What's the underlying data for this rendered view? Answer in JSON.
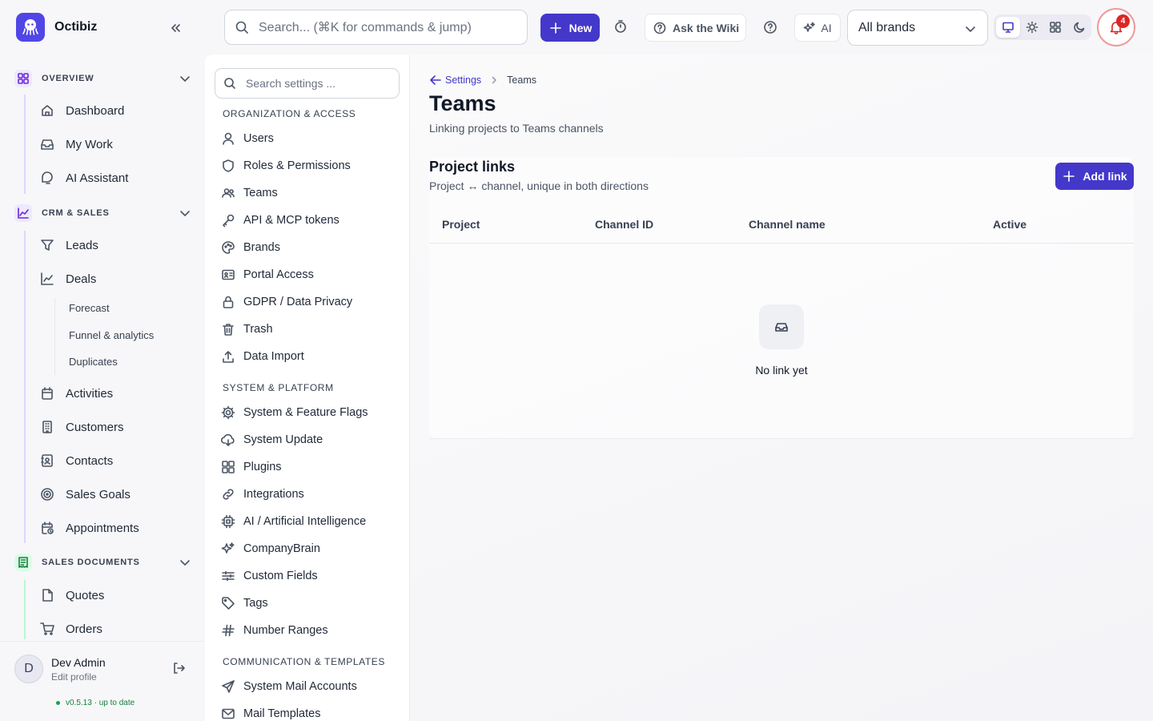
{
  "app": {
    "name": "Octibiz"
  },
  "topbar": {
    "search_placeholder": "Search... (⌘K for commands & jump)",
    "new_label": "New",
    "wiki_label": "Ask the Wiki",
    "ai_label": "AI",
    "brand_select": "All brands",
    "notifications_count": "4"
  },
  "sidebar": {
    "sections": [
      {
        "label": "OVERVIEW",
        "items": [
          "Dashboard",
          "My Work",
          "AI Assistant"
        ]
      },
      {
        "label": "CRM & SALES",
        "items": [
          "Leads",
          "Deals",
          "Activities",
          "Customers",
          "Contacts",
          "Sales Goals",
          "Appointments"
        ],
        "subitems": [
          "Forecast",
          "Funnel & analytics",
          "Duplicates"
        ]
      },
      {
        "label": "SALES DOCUMENTS",
        "items": [
          "Quotes",
          "Orders"
        ]
      }
    ],
    "user": {
      "name": "Dev Admin",
      "edit": "Edit profile",
      "initial": "D"
    },
    "version": "v0.5.13",
    "version_status": "· up to date"
  },
  "settings": {
    "search_placeholder": "Search settings ...",
    "groups": [
      {
        "label": "ORGANIZATION & ACCESS",
        "items": [
          "Users",
          "Roles & Permissions",
          "Teams",
          "API & MCP tokens",
          "Brands",
          "Portal Access",
          "GDPR / Data Privacy",
          "Trash",
          "Data Import"
        ]
      },
      {
        "label": "SYSTEM & PLATFORM",
        "items": [
          "System & Feature Flags",
          "System Update",
          "Plugins",
          "Integrations",
          "AI / Artificial Intelligence",
          "CompanyBrain",
          "Custom Fields",
          "Tags",
          "Number Ranges"
        ]
      },
      {
        "label": "COMMUNICATION & TEMPLATES",
        "items": [
          "System Mail Accounts",
          "Mail Templates"
        ]
      }
    ]
  },
  "main": {
    "breadcrumb": {
      "back": "Settings",
      "current": "Teams"
    },
    "title": "Teams",
    "subtitle": "Linking projects to Teams channels",
    "card": {
      "title": "Project links",
      "subtitle": "Project ↔ channel, unique in both directions",
      "add_label": "Add link",
      "columns": [
        "Project",
        "Channel ID",
        "Channel name",
        "Active"
      ],
      "empty": "No link yet"
    }
  },
  "colors": {
    "accent": "#4338ca",
    "notification": "#dc2626",
    "status_ok": "#16a34a"
  }
}
